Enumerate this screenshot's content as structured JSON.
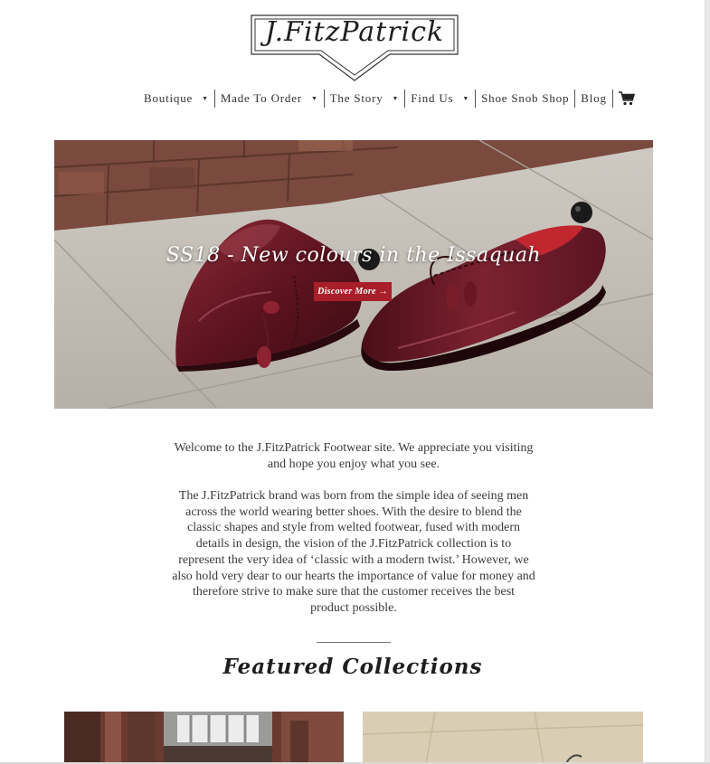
{
  "logo": {
    "text": "J.FitzPatrick"
  },
  "nav": {
    "items": [
      {
        "label": "Boutique",
        "dropdown": true
      },
      {
        "label": "Made To Order",
        "dropdown": true
      },
      {
        "label": "The Story",
        "dropdown": true
      },
      {
        "label": "Find Us",
        "dropdown": true
      },
      {
        "label": "Shoe Snob Shop",
        "dropdown": false
      },
      {
        "label": "Blog",
        "dropdown": false
      }
    ],
    "cart_icon": "cart-icon"
  },
  "hero": {
    "title": "SS18 - New colours in the Issaquah",
    "button": "Discover More →"
  },
  "intro": "Welcome to the J.FitzPatrick Footwear site. We appreciate you visiting and hope you enjoy what you see.",
  "about": "The J.FitzPatrick brand was born from the simple idea of seeing men across the world wearing better shoes. With the desire to blend the classic shapes and style from welted footwear, fused with modern details in design, the vision of the J.FitzPatrick collection is to represent the very idea of ‘classic with a modern twist.’ However, we also hold very dear to our hearts the importance of value for money and therefore strive to make sure that the customer receives the best product possible.",
  "featured": {
    "title": "Featured Collections"
  },
  "colors": {
    "accent": "#a81f2a",
    "text": "#3a3a3a",
    "shoe": "#6b1620"
  }
}
